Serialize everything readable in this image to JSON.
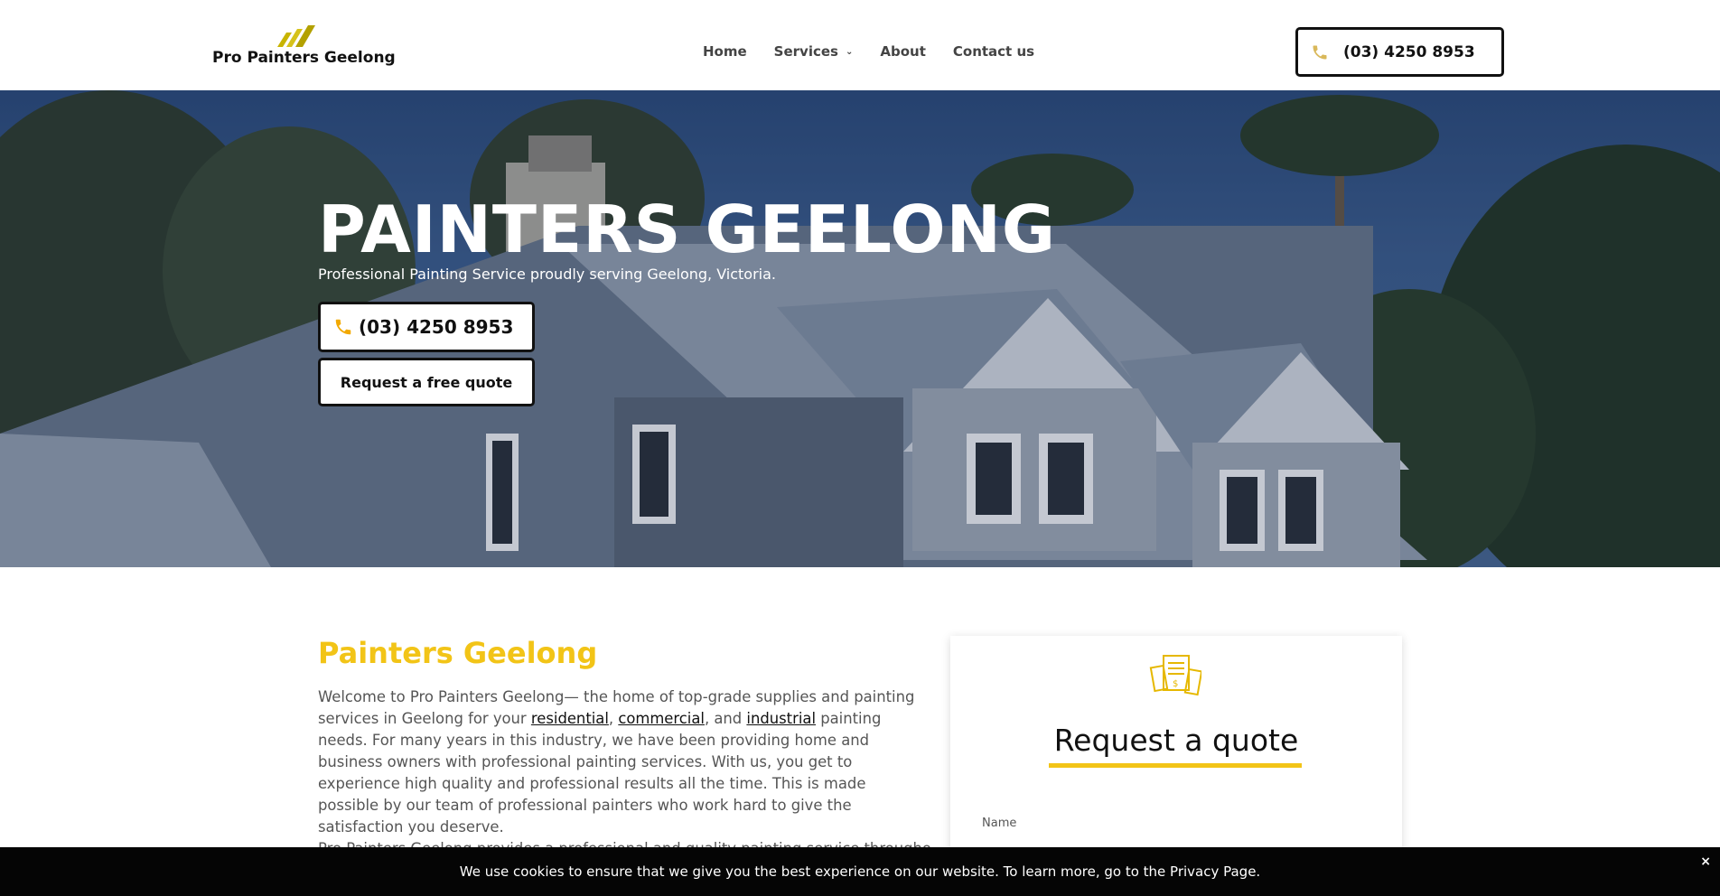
{
  "header": {
    "logo_text": "Pro Painters Geelong",
    "nav": [
      {
        "label": "Home"
      },
      {
        "label": "Services"
      },
      {
        "label": "About"
      },
      {
        "label": "Contact us"
      }
    ],
    "phone": "(03) 4250 8953"
  },
  "hero": {
    "title": "PAINTERS GEELONG",
    "subtitle": "Professional Painting Service proudly serving Geelong, Victoria.",
    "phone_button": "(03) 4250 8953",
    "quote_button": "Request a free quote"
  },
  "content": {
    "title": "Painters Geelong",
    "p1_a": "Welcome to Pro Painters Geelong— the home of top-grade supplies and painting services in Geelong for your ",
    "link_residential": "residential",
    "sep1": ", ",
    "link_commercial": "commercial",
    "sep2": ", and ",
    "link_industrial": "industrial",
    "p1_b": " painting needs. For many years in this industry, we have been providing home and business owners with professional painting services. With us, you get to experience high quality and professional results all the time. This is made possible by our team of professional painters who work hard to give the satisfaction you deserve.",
    "p2": "Pro Painters Geelong provides a professional and quality painting service throughout"
  },
  "quote_form": {
    "heading": "Request a quote",
    "name_label": "Name"
  },
  "cookie": {
    "text": "We use cookies to ensure that we give you the best experience on our website. To learn more, go to the Privacy Page.",
    "close": "×"
  },
  "colors": {
    "accent": "#f2c417",
    "dark": "#111111"
  }
}
